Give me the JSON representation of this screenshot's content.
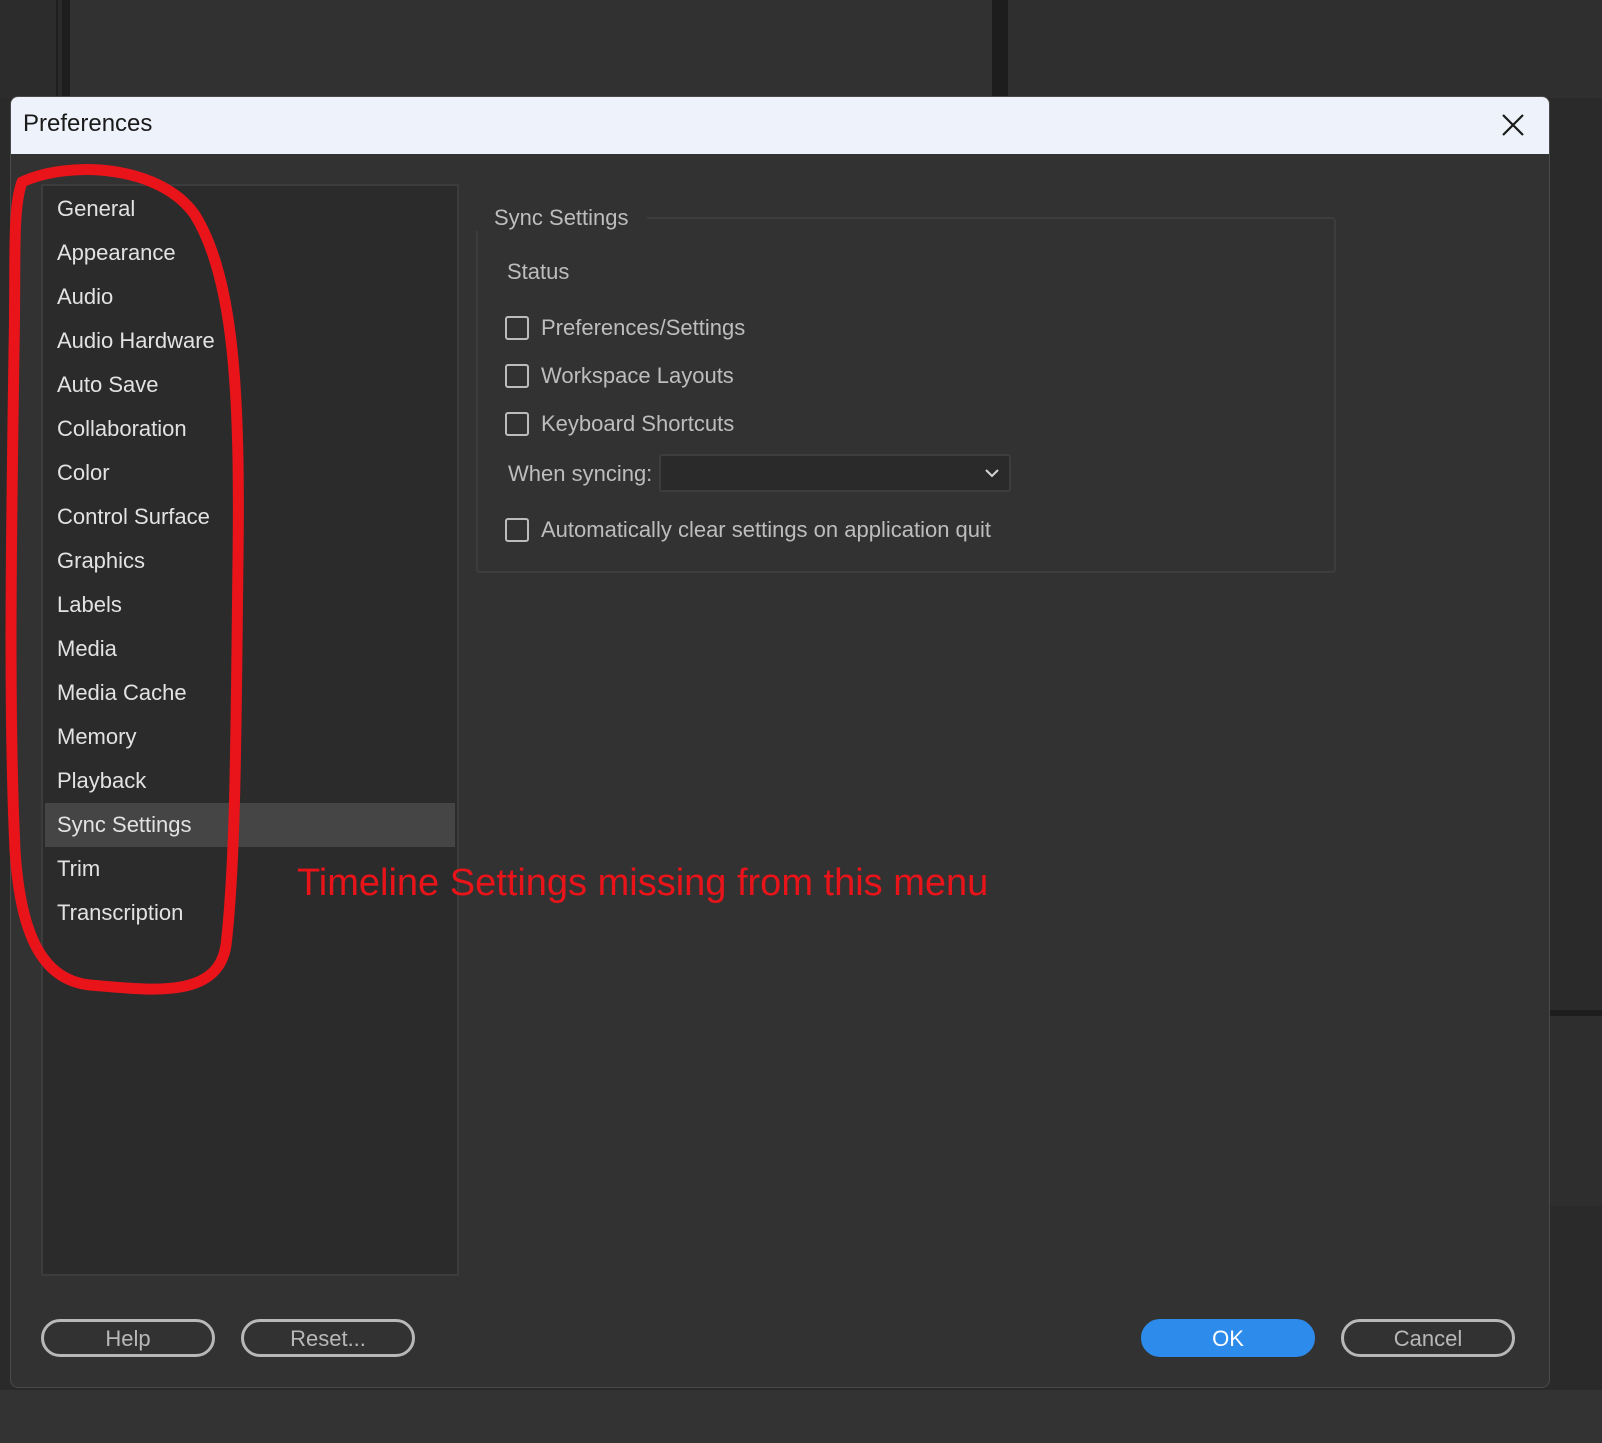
{
  "dialog": {
    "title": "Preferences"
  },
  "nav": {
    "items": [
      {
        "label": "General",
        "selected": false
      },
      {
        "label": "Appearance",
        "selected": false
      },
      {
        "label": "Audio",
        "selected": false
      },
      {
        "label": "Audio Hardware",
        "selected": false
      },
      {
        "label": "Auto Save",
        "selected": false
      },
      {
        "label": "Collaboration",
        "selected": false
      },
      {
        "label": "Color",
        "selected": false
      },
      {
        "label": "Control Surface",
        "selected": false
      },
      {
        "label": "Graphics",
        "selected": false
      },
      {
        "label": "Labels",
        "selected": false
      },
      {
        "label": "Media",
        "selected": false
      },
      {
        "label": "Media Cache",
        "selected": false
      },
      {
        "label": "Memory",
        "selected": false
      },
      {
        "label": "Playback",
        "selected": false
      },
      {
        "label": "Sync Settings",
        "selected": true
      },
      {
        "label": "Trim",
        "selected": false
      },
      {
        "label": "Transcription",
        "selected": false
      }
    ]
  },
  "sync": {
    "group_title": "Sync Settings",
    "status_label": "Status",
    "checkboxes": [
      {
        "label": "Preferences/Settings",
        "checked": false
      },
      {
        "label": "Workspace Layouts",
        "checked": false
      },
      {
        "label": "Keyboard Shortcuts",
        "checked": false
      }
    ],
    "when_syncing_label": "When syncing:",
    "when_syncing_value": "",
    "auto_clear": {
      "label": "Automatically clear settings on application quit",
      "checked": false
    }
  },
  "buttons": {
    "help": "Help",
    "reset": "Reset...",
    "ok": "OK",
    "cancel": "Cancel"
  },
  "annotation": {
    "text": "Timeline Settings missing from this menu",
    "color": "#e8141a"
  },
  "colors": {
    "accent": "#2d8ceb",
    "dialog_bg": "#323232",
    "titlebar_bg": "#eef2fa",
    "selected_item_bg": "#454545"
  }
}
